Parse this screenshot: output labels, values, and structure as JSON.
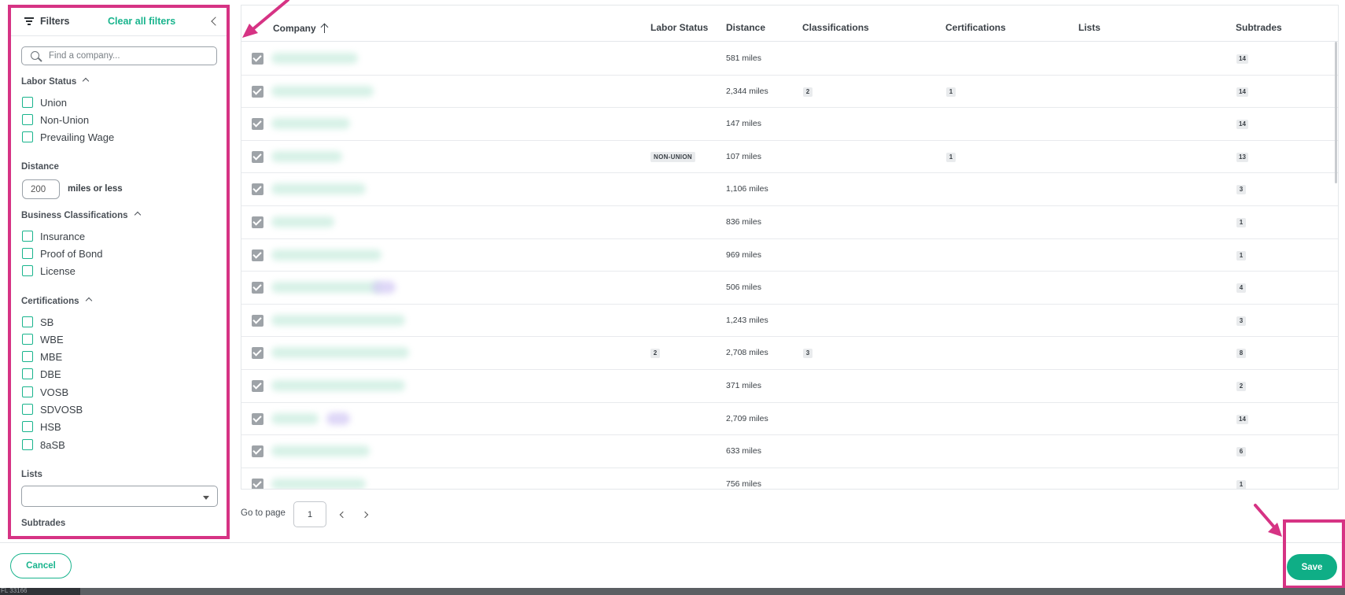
{
  "sidebar": {
    "title": "Filters",
    "clear_all": "Clear all filters",
    "search_placeholder": "Find a company...",
    "labor_status": {
      "title": "Labor Status",
      "options": [
        "Union",
        "Non-Union",
        "Prevailing Wage"
      ]
    },
    "distance": {
      "title": "Distance",
      "value": "200",
      "unit_label": "miles or less"
    },
    "business_classifications": {
      "title": "Business Classifications",
      "options": [
        "Insurance",
        "Proof of Bond",
        "License"
      ]
    },
    "certifications": {
      "title": "Certifications",
      "options": [
        "SB",
        "WBE",
        "MBE",
        "DBE",
        "VOSB",
        "SDVOSB",
        "HSB",
        "8aSB"
      ]
    },
    "lists": {
      "title": "Lists",
      "selected": ""
    },
    "subtrades": {
      "title": "Subtrades"
    }
  },
  "table": {
    "columns": [
      "Company",
      "Labor Status",
      "Distance",
      "Classifications",
      "Certifications",
      "Lists",
      "Subtrades"
    ],
    "rows": [
      {
        "labor": "",
        "distance": "581 miles",
        "classifications": "",
        "certifications": "",
        "subtrades": "14"
      },
      {
        "labor": "",
        "distance": "2,344 miles",
        "classifications": "2",
        "certifications": "1",
        "subtrades": "14"
      },
      {
        "labor": "",
        "distance": "147 miles",
        "classifications": "",
        "certifications": "",
        "subtrades": "14"
      },
      {
        "labor": "NON-UNION",
        "distance": "107 miles",
        "classifications": "",
        "certifications": "1",
        "subtrades": "13"
      },
      {
        "labor": "",
        "distance": "1,106 miles",
        "classifications": "",
        "certifications": "",
        "subtrades": "3"
      },
      {
        "labor": "",
        "distance": "836 miles",
        "classifications": "",
        "certifications": "",
        "subtrades": "1"
      },
      {
        "labor": "",
        "distance": "969 miles",
        "classifications": "",
        "certifications": "",
        "subtrades": "1"
      },
      {
        "labor": "",
        "distance": "506 miles",
        "classifications": "",
        "certifications": "",
        "subtrades": "4"
      },
      {
        "labor": "",
        "distance": "1,243 miles",
        "classifications": "",
        "certifications": "",
        "subtrades": "3"
      },
      {
        "labor": "2",
        "distance": "2,708 miles",
        "classifications": "3",
        "certifications": "",
        "subtrades": "8"
      },
      {
        "labor": "",
        "distance": "371 miles",
        "classifications": "",
        "certifications": "",
        "subtrades": "2"
      },
      {
        "labor": "",
        "distance": "2,709 miles",
        "classifications": "",
        "certifications": "",
        "subtrades": "14"
      },
      {
        "labor": "",
        "distance": "633 miles",
        "classifications": "",
        "certifications": "",
        "subtrades": "6"
      },
      {
        "labor": "",
        "distance": "756 miles",
        "classifications": "",
        "certifications": "",
        "subtrades": "1"
      }
    ]
  },
  "pagination": {
    "go_to_label": "Go to page",
    "current_page": "1"
  },
  "footer": {
    "cancel_label": "Cancel",
    "save_label": "Save"
  },
  "bottom_bar_text": "FL 33166",
  "colors": {
    "accent": "#19b48d",
    "highlight": "#d63384"
  }
}
